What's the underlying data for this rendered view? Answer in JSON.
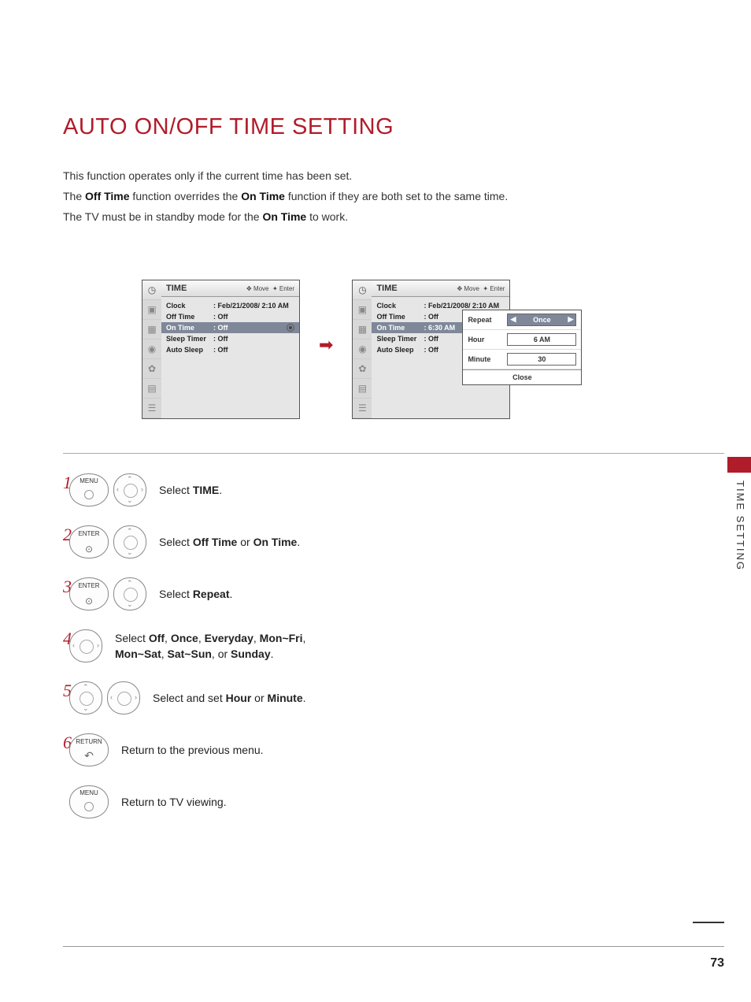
{
  "title": "AUTO ON/OFF TIME SETTING",
  "intro": {
    "line1": "This function operates only if the current time has been set.",
    "line2_a": "The ",
    "line2_b": "Off Time",
    "line2_c": " function overrides the ",
    "line2_d": "On Time",
    "line2_e": " function if they are both set to the same time.",
    "line3_a": "The TV must be in standby mode for the ",
    "line3_b": "On Time",
    "line3_c": " to work."
  },
  "osd": {
    "header": "TIME",
    "hint_move": "Move",
    "hint_enter": "Enter",
    "rows": [
      {
        "label": "Clock",
        "value": "Feb/21/2008/  2:10 AM"
      },
      {
        "label": "Off Time",
        "value": "Off"
      },
      {
        "label": "On Time",
        "value": "Off"
      },
      {
        "label": "Sleep Timer",
        "value": "Off"
      },
      {
        "label": "Auto Sleep",
        "value": "Off"
      }
    ],
    "rows2": [
      {
        "label": "Clock",
        "value": "Feb/21/2008/  2:10 AM"
      },
      {
        "label": "Off Time",
        "value": "Off"
      },
      {
        "label": "On Time",
        "value": "6:30 AM"
      },
      {
        "label": "Sleep Timer",
        "value": "Off"
      },
      {
        "label": "Auto Sleep",
        "value": "Off"
      }
    ],
    "popover": {
      "repeat_label": "Repeat",
      "repeat_value": "Once",
      "hour_label": "Hour",
      "hour_value": "6 AM",
      "minute_label": "Minute",
      "minute_value": "30",
      "close": "Close"
    }
  },
  "steps": {
    "s1_a": "Select ",
    "s1_b": "TIME",
    "s1_c": ".",
    "s2_a": "Select ",
    "s2_b": "Off Time",
    "s2_c": " or ",
    "s2_d": "On Time",
    "s2_e": ".",
    "s3_a": "Select ",
    "s3_b": "Repeat",
    "s3_c": ".",
    "s4_a": "Select ",
    "s4_b": "Off",
    "s4_c": ", ",
    "s4_d": "Once",
    "s4_e": ", ",
    "s4_f": "Everyday",
    "s4_g": ", ",
    "s4_h": "Mon~Fri",
    "s4_i": ", ",
    "s4_j": "Mon~Sat",
    "s4_k": ", ",
    "s4_l": "Sat~Sun",
    "s4_m": ", or ",
    "s4_n": "Sunday",
    "s4_o": ".",
    "s5_a": "Select and set ",
    "s5_b": "Hour",
    "s5_c": " or ",
    "s5_d": "Minute",
    "s5_e": ".",
    "s6": "Return to the previous menu.",
    "s7": "Return to TV viewing."
  },
  "buttons": {
    "menu": "MENU",
    "enter": "ENTER",
    "return": "RETURN"
  },
  "side_label": "TIME SETTING",
  "page_number": "73"
}
